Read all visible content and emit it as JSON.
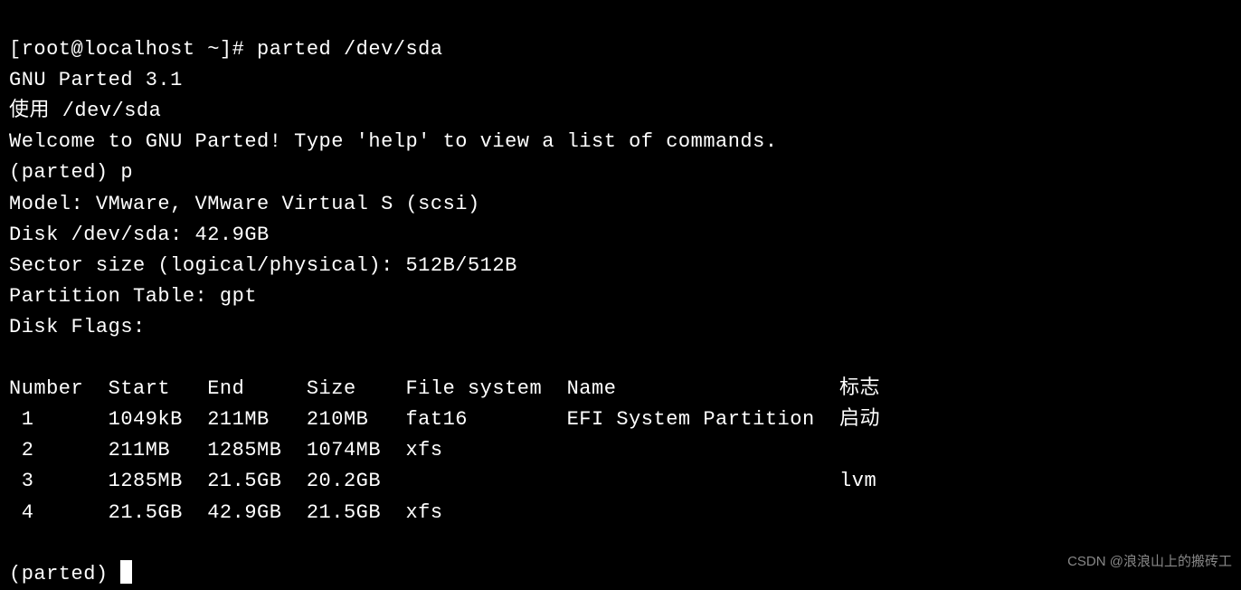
{
  "prompt": {
    "user_host": "[root@localhost ~]# ",
    "command": "parted /dev/sda"
  },
  "intro": {
    "version": "GNU Parted 3.1",
    "using": "使用 /dev/sda",
    "welcome": "Welcome to GNU Parted! Type 'help' to view a list of commands."
  },
  "parted_prompt1": "(parted) p",
  "disk_info": {
    "model": "Model: VMware, VMware Virtual S (scsi)",
    "disk": "Disk /dev/sda: 42.9GB",
    "sector": "Sector size (logical/physical): 512B/512B",
    "table": "Partition Table: gpt",
    "flags": "Disk Flags: "
  },
  "table": {
    "header": "Number  Start   End     Size    File system  Name                  标志",
    "rows": [
      " 1      1049kB  211MB   210MB   fat16        EFI System Partition  启动",
      " 2      211MB   1285MB  1074MB  xfs",
      " 3      1285MB  21.5GB  20.2GB                                     lvm",
      " 4      21.5GB  42.9GB  21.5GB  xfs"
    ]
  },
  "parted_prompt2": "(parted) ",
  "watermark": "CSDN @浪浪山上的搬砖工"
}
